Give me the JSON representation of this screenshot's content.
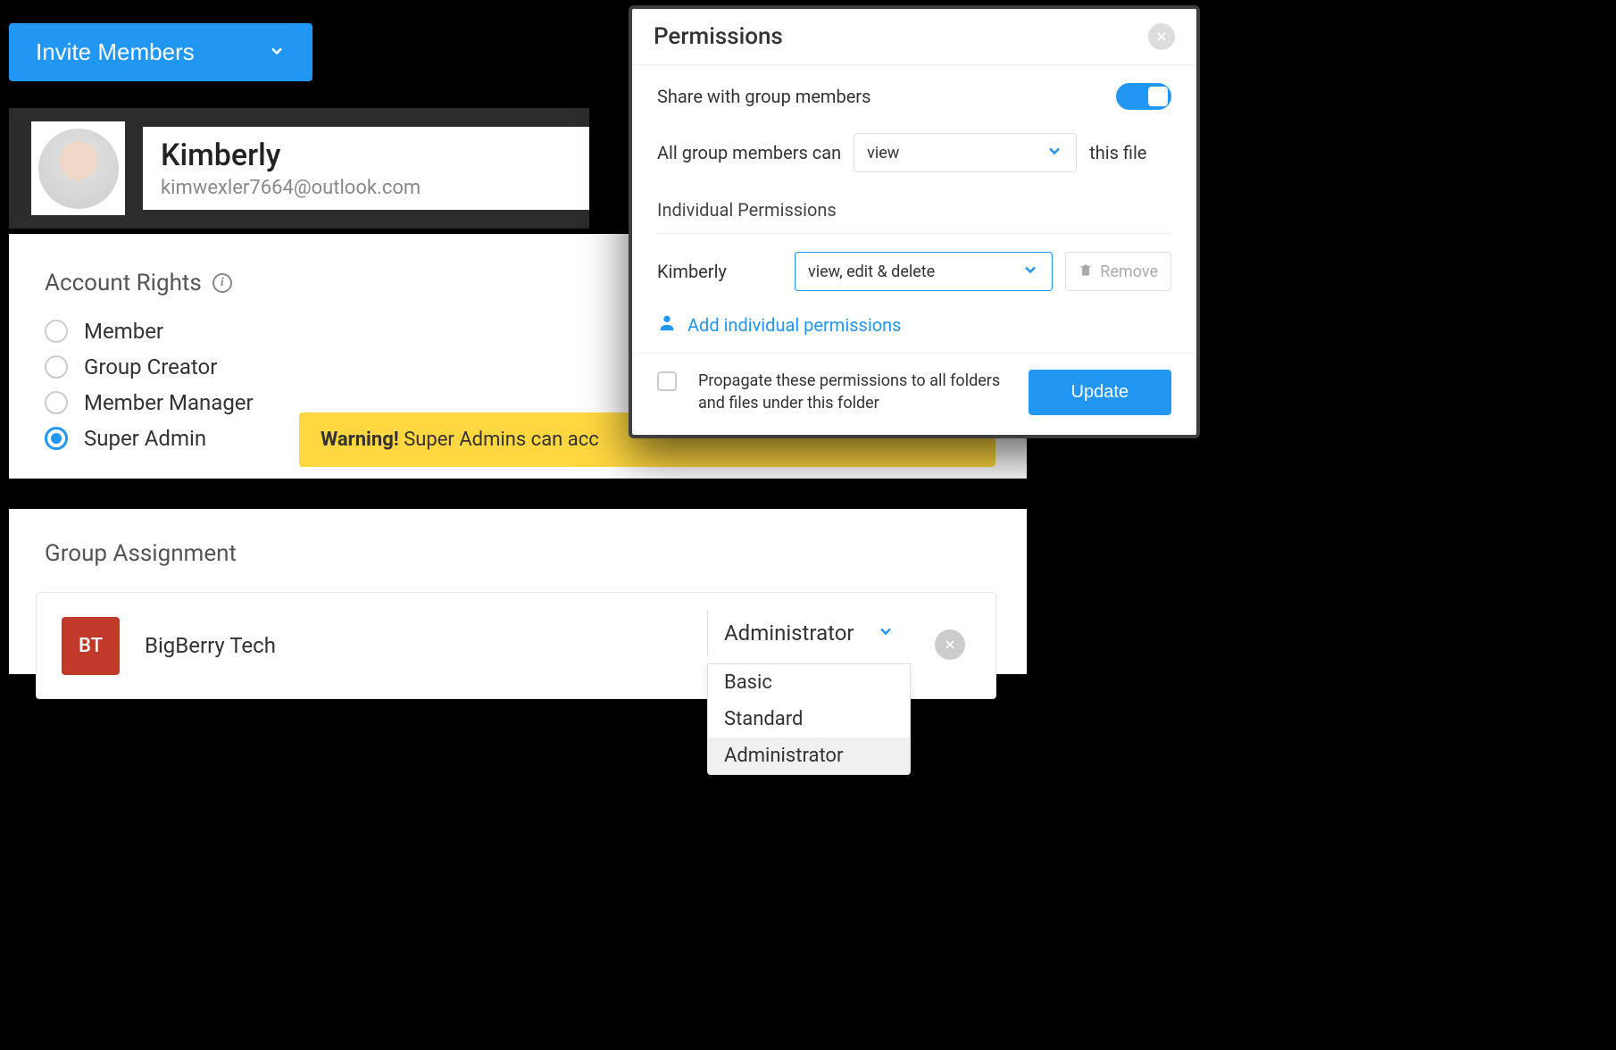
{
  "invite": {
    "label": "Invite Members"
  },
  "profile": {
    "name": "Kimberly",
    "email": "kimwexler7664@outlook.com"
  },
  "accountRights": {
    "heading": "Account Rights",
    "options": [
      "Member",
      "Group Creator",
      "Member Manager",
      "Super Admin"
    ],
    "selected": "Super Admin",
    "warning_prefix": "Warning!",
    "warning_text": " Super Admins can acc"
  },
  "groupAssignment": {
    "heading": "Group Assignment",
    "badge": "BT",
    "name": "BigBerry Tech",
    "role": "Administrator",
    "options": [
      "Basic",
      "Standard",
      "Administrator"
    ],
    "selected": "Administrator"
  },
  "modal": {
    "title": "Permissions",
    "share_label": "Share with group members",
    "members_prefix": "All group members can",
    "members_value": "view",
    "members_suffix": "this file",
    "individual_heading": "Individual Permissions",
    "individual_name": "Kimberly",
    "individual_value": "view, edit & delete",
    "remove_label": "Remove",
    "add_link": "Add individual permissions",
    "propagate_text": "Propagate these permissions to all folders and files under this folder",
    "update_label": "Update"
  }
}
